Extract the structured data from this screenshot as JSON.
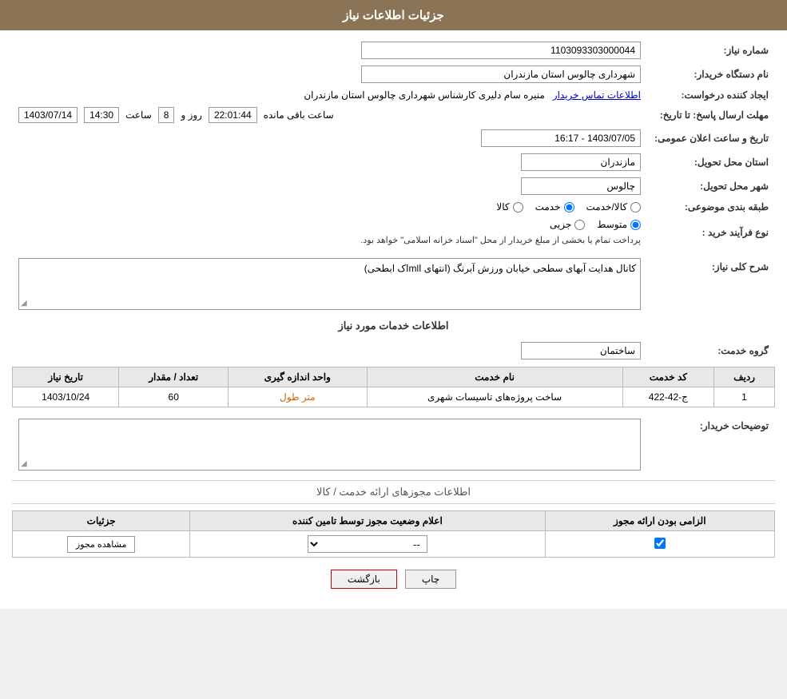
{
  "header": {
    "title": "جزئیات اطلاعات نیاز"
  },
  "fields": {
    "need_number_label": "شماره نیاز:",
    "need_number_value": "1103093303000044",
    "buyer_org_label": "نام دستگاه خریدار:",
    "buyer_org_value": "شهرداری چالوس استان مازندران",
    "creator_label": "ایجاد کننده درخواست:",
    "creator_value": "منیره سام دلیری کارشناس شهرداری چالوس استان مازندران",
    "creator_link": "اطلاعات تماس خریدار",
    "deadline_label": "مهلت ارسال پاسخ: تا تاریخ:",
    "deadline_date": "1403/07/14",
    "deadline_time_label": "ساعت",
    "deadline_time": "14:30",
    "deadline_day_label": "روز و",
    "deadline_days": "8",
    "deadline_remaining_label": "ساعت باقی مانده",
    "deadline_remaining": "22:01:44",
    "announce_label": "تاریخ و ساعت اعلان عمومی:",
    "announce_value": "1403/07/05 - 16:17",
    "province_label": "استان محل تحویل:",
    "province_value": "مازندران",
    "city_label": "شهر محل تحویل:",
    "city_value": "چالوس",
    "category_label": "طبقه بندی موضوعی:",
    "category_options": [
      "کالا",
      "خدمت",
      "کالا/خدمت"
    ],
    "category_selected": "خدمت",
    "process_label": "نوع فرآیند خرید :",
    "process_options": [
      "جزیی",
      "متوسط"
    ],
    "process_selected": "متوسط",
    "process_note": "پرداخت تمام یا بخشی از مبلغ خریدار از محل \"اسناد خزانه اسلامی\" خواهد بود.",
    "need_desc_label": "شرح کلی نیاز:",
    "need_desc_value": "کانال هدایت آبهای سطحی خیابان ورزش آبرنگ (انتهای اmlاک ابطحی)",
    "services_section_title": "اطلاعات خدمات مورد نیاز",
    "service_group_label": "گروه خدمت:",
    "service_group_value": "ساختمان",
    "services_table": {
      "columns": [
        "ردیف",
        "کد خدمت",
        "نام خدمت",
        "واحد اندازه گیری",
        "تعداد / مقدار",
        "تاریخ نیاز"
      ],
      "rows": [
        {
          "row_num": "1",
          "service_code": "ج-42-422",
          "service_name": "ساخت پروژه‌های تاسیسات شهری",
          "unit": "متر طول",
          "quantity": "60",
          "date": "1403/10/24"
        }
      ]
    },
    "buyer_notes_label": "توضیحات خریدار:",
    "buyer_notes_value": "",
    "permits_section_title": "اطلاعات مجوزهای ارائه خدمت / کالا",
    "permits_table": {
      "columns": [
        "الزامی بودن ارائه مجوز",
        "اعلام وضعیت مجوز توسط تامین کننده",
        "جزئیات"
      ],
      "rows": [
        {
          "required": true,
          "status": "--",
          "details_btn": "مشاهده مجوز"
        }
      ]
    },
    "print_btn": "چاپ",
    "back_btn": "بازگشت"
  }
}
